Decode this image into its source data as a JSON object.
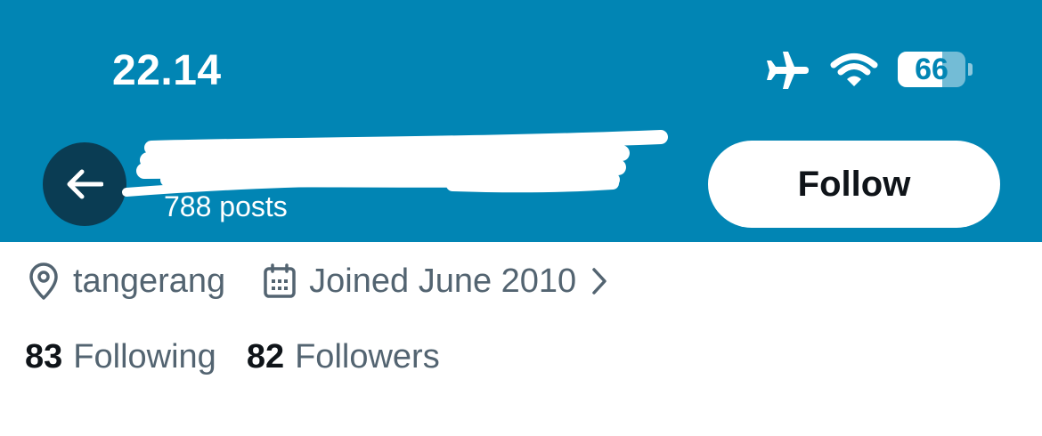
{
  "status_bar": {
    "time": "22.14",
    "battery_level": "66",
    "battery_fraction": 0.66,
    "icons": [
      "airplane-icon",
      "wifi-icon",
      "battery-icon"
    ]
  },
  "header": {
    "post_count": "788 posts",
    "follow_label": "Follow",
    "background_color": "#0185b4"
  },
  "profile": {
    "location": "tangerang",
    "joined": "Joined June 2010",
    "following_count": "83",
    "following_label": "Following",
    "followers_count": "82",
    "followers_label": "Followers"
  }
}
